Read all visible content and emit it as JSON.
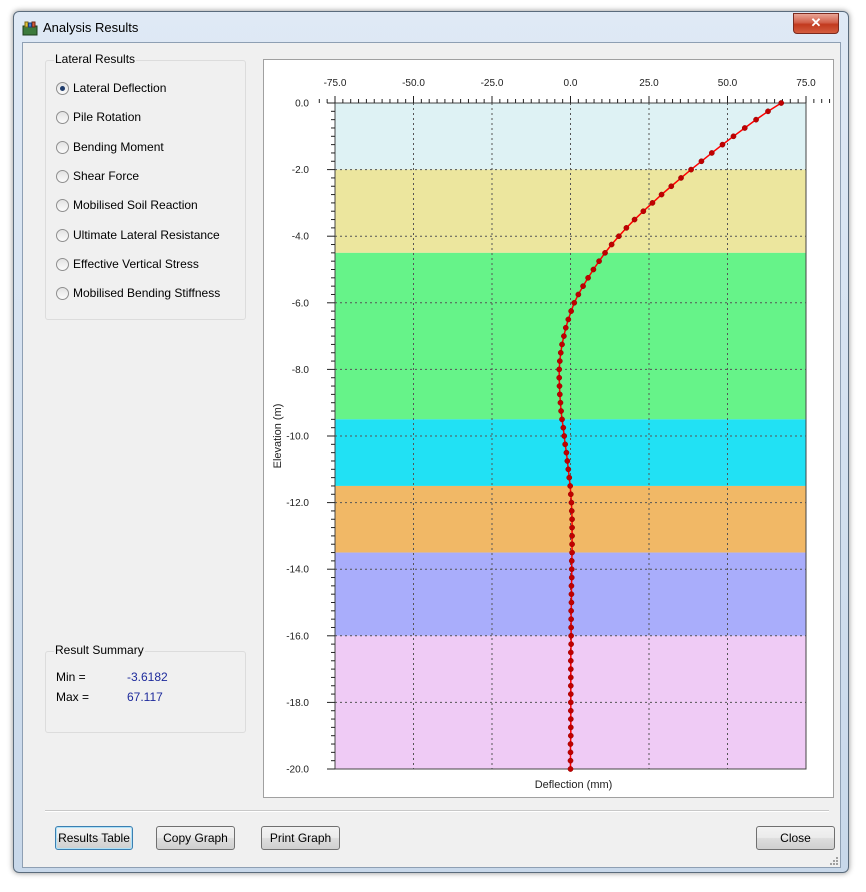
{
  "window": {
    "title": "Analysis Results",
    "close_glyph": "✕"
  },
  "lateral_results": {
    "title": "Lateral Results",
    "options": [
      {
        "label": "Lateral Deflection",
        "selected": true
      },
      {
        "label": "Pile Rotation",
        "selected": false
      },
      {
        "label": "Bending Moment",
        "selected": false
      },
      {
        "label": "Shear Force",
        "selected": false
      },
      {
        "label": "Mobilised Soil Reaction",
        "selected": false
      },
      {
        "label": "Ultimate Lateral Resistance",
        "selected": false
      },
      {
        "label": "Effective Vertical Stress",
        "selected": false
      },
      {
        "label": "Mobilised Bending Stiffness",
        "selected": false
      }
    ]
  },
  "result_summary": {
    "title": "Result Summary",
    "min_label": "Min =",
    "min_value": "-3.6182",
    "max_label": "Max =",
    "max_value": "67.117"
  },
  "buttons": {
    "results_table": "Results Table",
    "copy_graph": "Copy Graph",
    "print_graph": "Print Graph",
    "close": "Close"
  },
  "chart_data": {
    "type": "line",
    "xlabel": "Deflection (mm)",
    "ylabel": "Elevation (m)",
    "xlim": [
      -75,
      75
    ],
    "ylim": [
      -20,
      0
    ],
    "x_axis_position": "top",
    "x_ticks": [
      "-75.0",
      "-50.0",
      "-25.0",
      "0.0",
      "25.0",
      "50.0",
      "75.0"
    ],
    "y_ticks": [
      "0.0",
      "-2.0",
      "-4.0",
      "-6.0",
      "-8.0",
      "-10.0",
      "-12.0",
      "-14.0",
      "-16.0",
      "-18.0",
      "-20.0"
    ],
    "grid": true,
    "soil_layers": [
      {
        "top": 0.0,
        "bottom": -2.0,
        "color": "#def2f4"
      },
      {
        "top": -2.0,
        "bottom": -4.5,
        "color": "#ece69e"
      },
      {
        "top": -4.5,
        "bottom": -9.5,
        "color": "#66f389"
      },
      {
        "top": -9.5,
        "bottom": -11.5,
        "color": "#21e1f4"
      },
      {
        "top": -11.5,
        "bottom": -13.5,
        "color": "#f1b866"
      },
      {
        "top": -13.5,
        "bottom": -16.0,
        "color": "#a9adfb"
      },
      {
        "top": -16.0,
        "bottom": -20.0,
        "color": "#efcbf5"
      }
    ],
    "series": [
      {
        "color": "#ff0000",
        "marker_color": "#c00000",
        "x": [
          67.1,
          62.9,
          59.1,
          55.5,
          51.9,
          48.4,
          45.0,
          41.7,
          38.4,
          35.2,
          32.1,
          29.0,
          26.1,
          23.2,
          20.4,
          17.8,
          15.4,
          13.1,
          11.0,
          9.1,
          7.3,
          5.6,
          4.0,
          2.5,
          1.2,
          0.2,
          -0.7,
          -1.5,
          -2.1,
          -2.7,
          -3.1,
          -3.4,
          -3.6,
          -3.6,
          -3.5,
          -3.4,
          -3.2,
          -3.0,
          -2.7,
          -2.3,
          -2.0,
          -1.7,
          -1.3,
          -1.0,
          -0.7,
          -0.4,
          -0.1,
          0.1,
          0.3,
          0.4,
          0.5,
          0.5,
          0.5,
          0.5,
          0.5,
          0.4,
          0.4,
          0.4,
          0.3,
          0.3,
          0.3,
          0.2,
          0.2,
          0.2,
          0.2,
          0.2,
          0.1,
          0.1,
          0.1,
          0.1,
          0.1,
          0.1,
          0.1,
          0.1,
          0.1,
          0.1,
          0.1,
          0.0,
          0.0,
          0.0,
          0.0
        ],
        "y": [
          0.0,
          -0.25,
          -0.5,
          -0.75,
          -1.0,
          -1.25,
          -1.5,
          -1.75,
          -2.0,
          -2.25,
          -2.5,
          -2.75,
          -3.0,
          -3.25,
          -3.5,
          -3.75,
          -4.0,
          -4.25,
          -4.5,
          -4.75,
          -5.0,
          -5.25,
          -5.5,
          -5.75,
          -6.0,
          -6.25,
          -6.5,
          -6.75,
          -7.0,
          -7.25,
          -7.5,
          -7.75,
          -8.0,
          -8.25,
          -8.5,
          -8.75,
          -9.0,
          -9.25,
          -9.5,
          -9.75,
          -10.0,
          -10.25,
          -10.5,
          -10.75,
          -11.0,
          -11.25,
          -11.5,
          -11.75,
          -12.0,
          -12.25,
          -12.5,
          -12.75,
          -13.0,
          -13.25,
          -13.5,
          -13.75,
          -14.0,
          -14.25,
          -14.5,
          -14.75,
          -15.0,
          -15.25,
          -15.5,
          -15.75,
          -16.0,
          -16.25,
          -16.5,
          -16.75,
          -17.0,
          -17.25,
          -17.5,
          -17.75,
          -18.0,
          -18.25,
          -18.5,
          -18.75,
          -19.0,
          -19.25,
          -19.5,
          -19.75,
          -20.0
        ]
      }
    ]
  }
}
